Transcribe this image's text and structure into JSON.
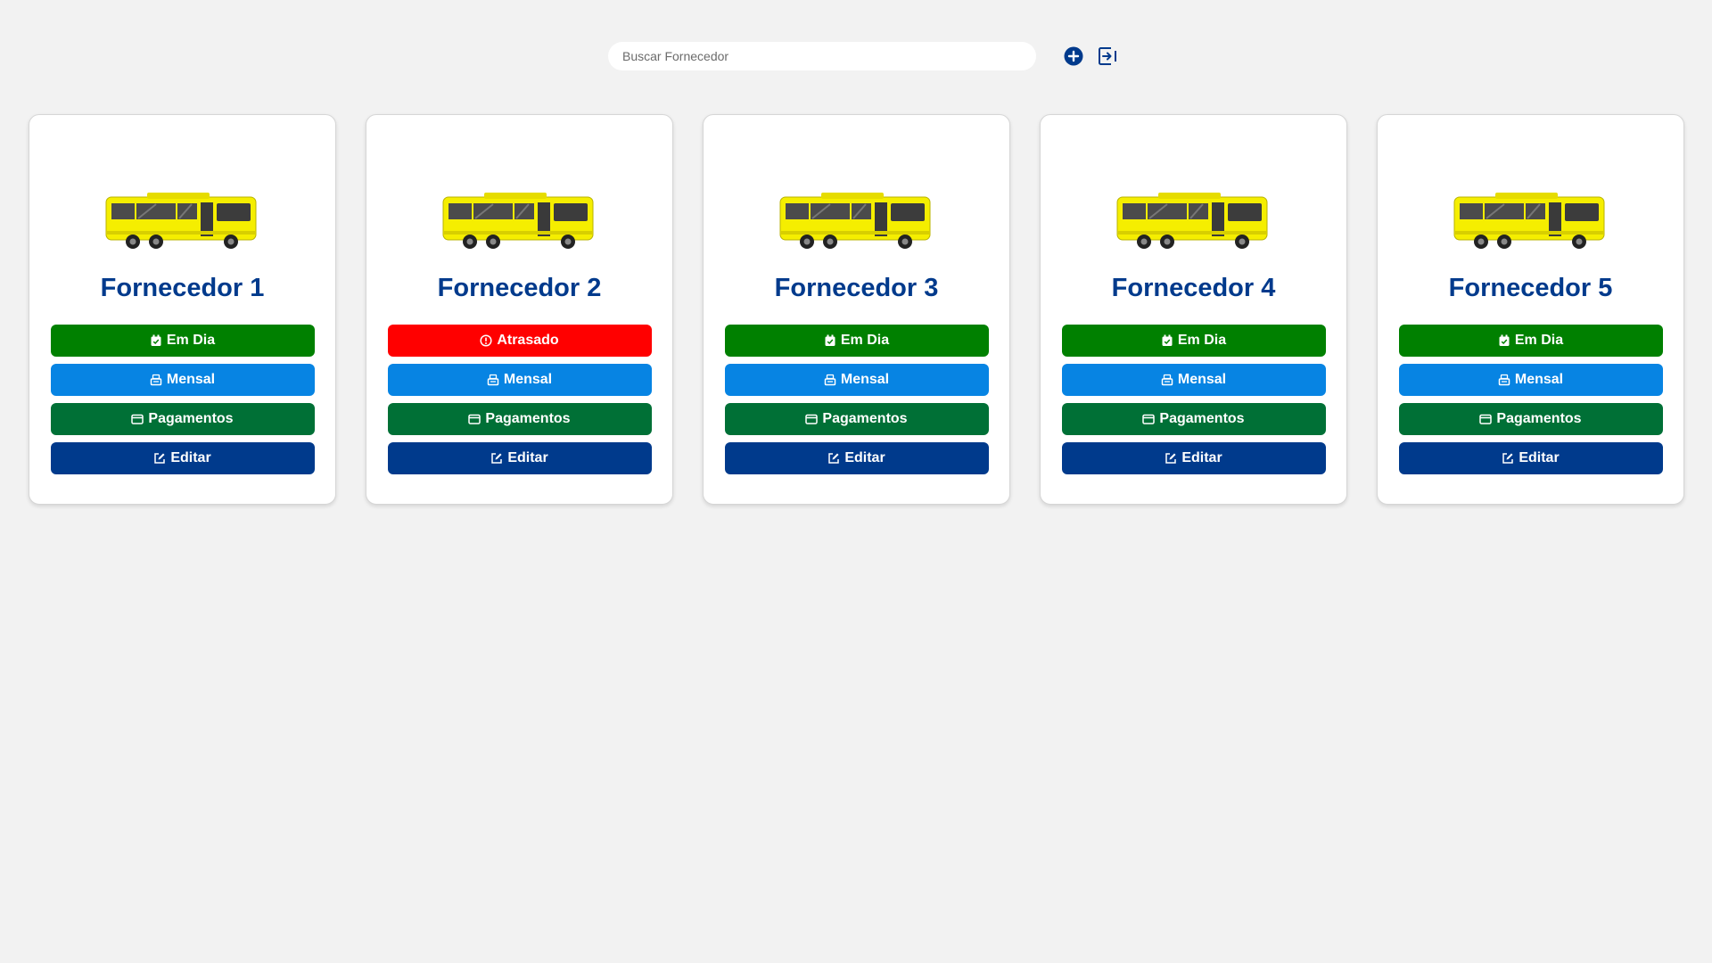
{
  "search": {
    "placeholder": "Buscar Fornecedor",
    "value": ""
  },
  "actions": {
    "add_icon": "plus-circle-icon",
    "logout_icon": "logout-icon"
  },
  "colors": {
    "primary": "#003a8c",
    "ok": "#008000",
    "late": "#ff0000",
    "mensal": "#0784e3",
    "pagamentos": "#007036",
    "bus_body": "#f5ee00"
  },
  "cards": [
    {
      "name": "Fornecedor 1",
      "status": "Em Dia",
      "status_type": "ok",
      "plan": "Mensal",
      "payments": "Pagamentos",
      "edit": "Editar"
    },
    {
      "name": "Fornecedor 2",
      "status": "Atrasado",
      "status_type": "late",
      "plan": "Mensal",
      "payments": "Pagamentos",
      "edit": "Editar"
    },
    {
      "name": "Fornecedor 3",
      "status": "Em Dia",
      "status_type": "ok",
      "plan": "Mensal",
      "payments": "Pagamentos",
      "edit": "Editar"
    },
    {
      "name": "Fornecedor 4",
      "status": "Em Dia",
      "status_type": "ok",
      "plan": "Mensal",
      "payments": "Pagamentos",
      "edit": "Editar"
    },
    {
      "name": "Fornecedor 5",
      "status": "Em Dia",
      "status_type": "ok",
      "plan": "Mensal",
      "payments": "Pagamentos",
      "edit": "Editar"
    }
  ]
}
